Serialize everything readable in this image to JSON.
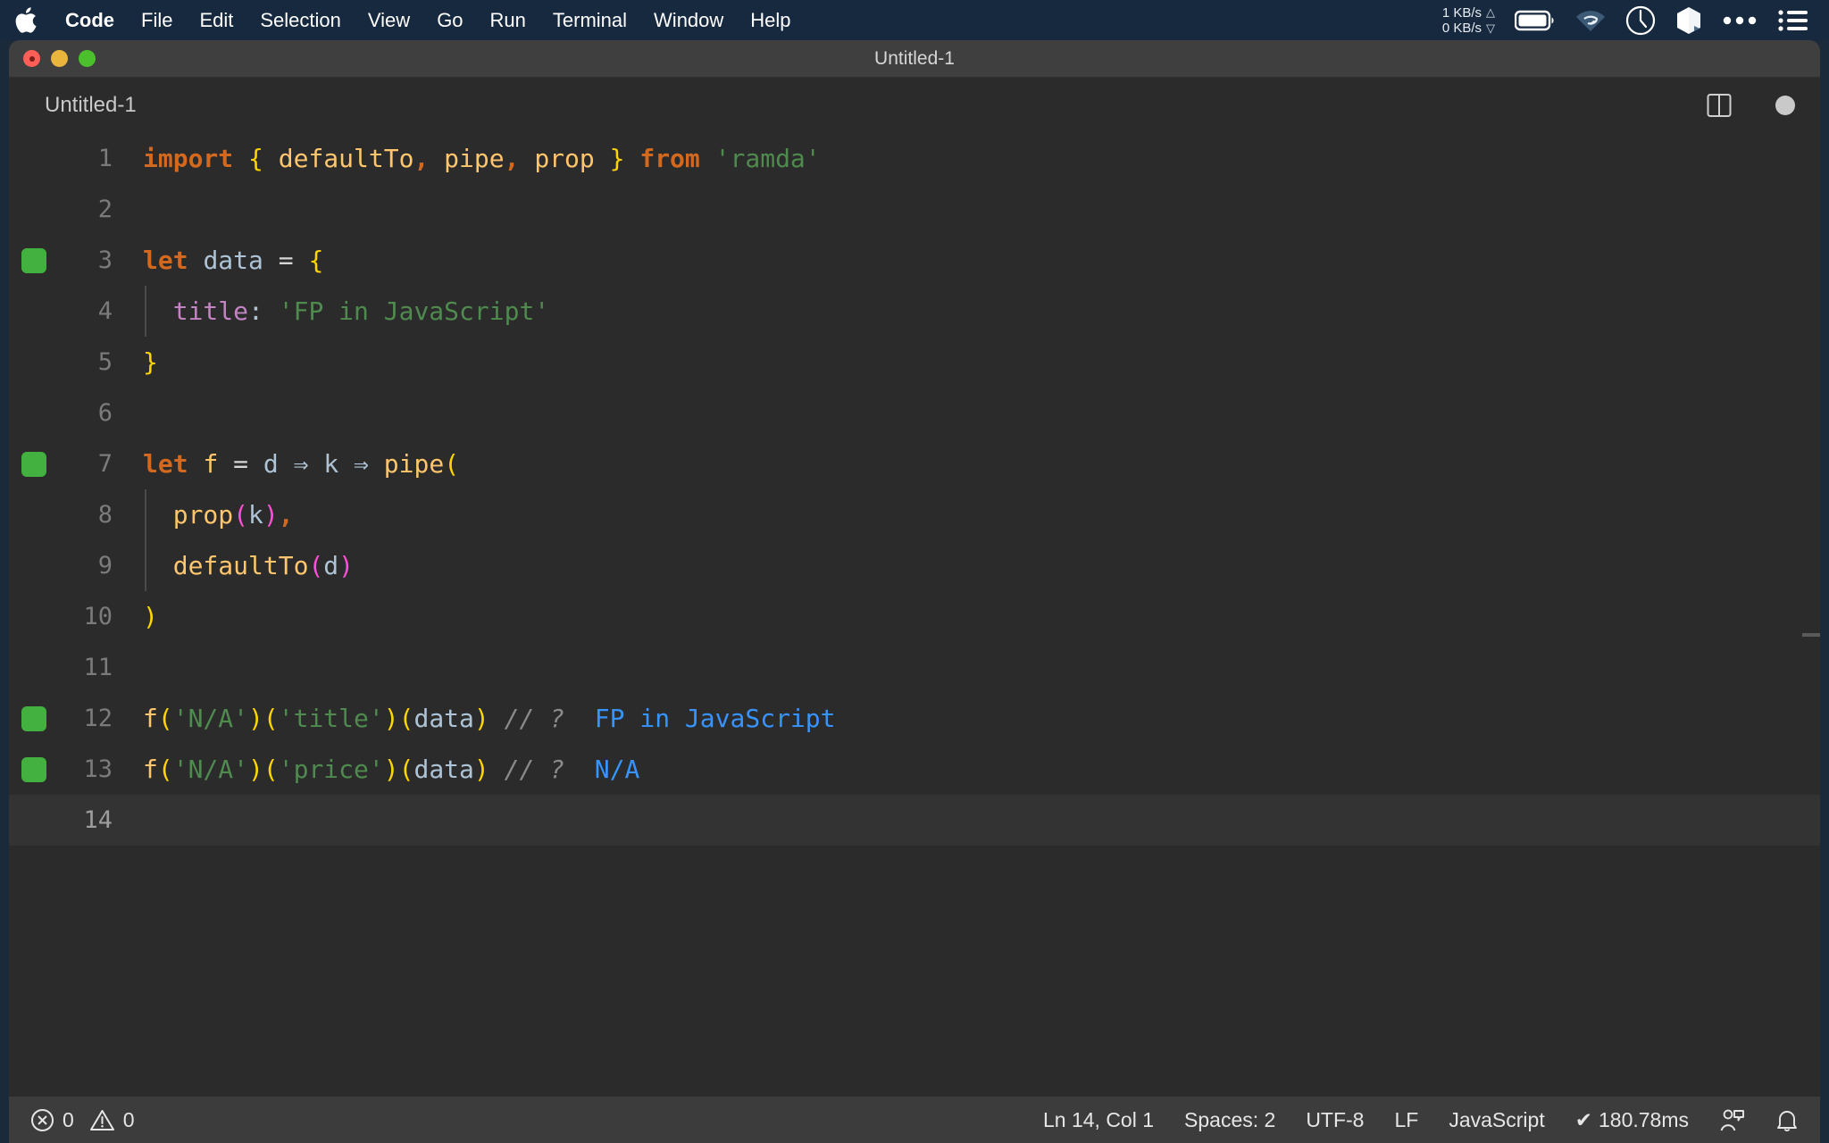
{
  "menubar": {
    "apple_icon": "apple-logo-icon",
    "items": [
      {
        "label": "Code",
        "bold": true
      },
      {
        "label": "File",
        "bold": false
      },
      {
        "label": "Edit",
        "bold": false
      },
      {
        "label": "Selection",
        "bold": false
      },
      {
        "label": "View",
        "bold": false
      },
      {
        "label": "Go",
        "bold": false
      },
      {
        "label": "Run",
        "bold": false
      },
      {
        "label": "Terminal",
        "bold": false
      },
      {
        "label": "Window",
        "bold": false
      },
      {
        "label": "Help",
        "bold": false
      }
    ],
    "network": {
      "upload": "1 KB/s",
      "download": "0 KB/s",
      "up_arrow": "△",
      "down_arrow": "▽"
    },
    "tray": [
      "battery-icon",
      "wifi-icon",
      "clock-icon",
      "dropbox-icon",
      "more-icon",
      "control-center-icon"
    ]
  },
  "window": {
    "title": "Untitled-1",
    "traffic_lights": [
      "close-button",
      "minimize-button",
      "maximize-button"
    ]
  },
  "tabs": {
    "active_label": "Untitled-1",
    "actions": [
      "split-editor-icon",
      "unsaved-dot-icon"
    ]
  },
  "editor": {
    "lines": [
      {
        "num": "1",
        "coverage": false,
        "current": false,
        "indent_guide": false,
        "tokens": [
          {
            "t": "import",
            "c": "kw"
          },
          {
            "t": " ",
            "c": "op"
          },
          {
            "t": "{",
            "c": "brace-y"
          },
          {
            "t": " ",
            "c": "op"
          },
          {
            "t": "defaultTo",
            "c": "fn"
          },
          {
            "t": ",",
            "c": "kw"
          },
          {
            "t": " ",
            "c": "op"
          },
          {
            "t": "pipe",
            "c": "fn"
          },
          {
            "t": ",",
            "c": "kw"
          },
          {
            "t": " ",
            "c": "op"
          },
          {
            "t": "prop",
            "c": "fn"
          },
          {
            "t": " ",
            "c": "op"
          },
          {
            "t": "}",
            "c": "brace-y"
          },
          {
            "t": " ",
            "c": "op"
          },
          {
            "t": "from",
            "c": "kw"
          },
          {
            "t": " ",
            "c": "op"
          },
          {
            "t": "'ramda'",
            "c": "str"
          }
        ]
      },
      {
        "num": "2",
        "coverage": false,
        "current": false,
        "indent_guide": false,
        "tokens": []
      },
      {
        "num": "3",
        "coverage": true,
        "current": false,
        "indent_guide": false,
        "tokens": [
          {
            "t": "let",
            "c": "kw"
          },
          {
            "t": " ",
            "c": "op"
          },
          {
            "t": "data",
            "c": "var"
          },
          {
            "t": " ",
            "c": "op"
          },
          {
            "t": "=",
            "c": "op"
          },
          {
            "t": " ",
            "c": "op"
          },
          {
            "t": "{",
            "c": "brace-y"
          }
        ]
      },
      {
        "num": "4",
        "coverage": false,
        "current": false,
        "indent_guide": true,
        "tokens": [
          {
            "t": "  ",
            "c": "op"
          },
          {
            "t": "title",
            "c": "prop"
          },
          {
            "t": ":",
            "c": "var"
          },
          {
            "t": " ",
            "c": "op"
          },
          {
            "t": "'FP in JavaScript'",
            "c": "str"
          }
        ]
      },
      {
        "num": "5",
        "coverage": false,
        "current": false,
        "indent_guide": false,
        "tokens": [
          {
            "t": "}",
            "c": "brace-y"
          }
        ]
      },
      {
        "num": "6",
        "coverage": false,
        "current": false,
        "indent_guide": false,
        "tokens": []
      },
      {
        "num": "7",
        "coverage": true,
        "current": false,
        "indent_guide": false,
        "tokens": [
          {
            "t": "let",
            "c": "kw"
          },
          {
            "t": " ",
            "c": "op"
          },
          {
            "t": "f",
            "c": "fn"
          },
          {
            "t": " ",
            "c": "op"
          },
          {
            "t": "=",
            "c": "op"
          },
          {
            "t": " ",
            "c": "op"
          },
          {
            "t": "d",
            "c": "var"
          },
          {
            "t": " ",
            "c": "op"
          },
          {
            "t": "⇒",
            "c": "arrow"
          },
          {
            "t": " ",
            "c": "op"
          },
          {
            "t": "k",
            "c": "var"
          },
          {
            "t": " ",
            "c": "op"
          },
          {
            "t": "⇒",
            "c": "arrow"
          },
          {
            "t": " ",
            "c": "op"
          },
          {
            "t": "pipe",
            "c": "fn"
          },
          {
            "t": "(",
            "c": "brace-y"
          }
        ]
      },
      {
        "num": "8",
        "coverage": false,
        "current": false,
        "indent_guide": true,
        "tokens": [
          {
            "t": "  ",
            "c": "op"
          },
          {
            "t": "prop",
            "c": "fn"
          },
          {
            "t": "(",
            "c": "paren-m"
          },
          {
            "t": "k",
            "c": "var"
          },
          {
            "t": ")",
            "c": "paren-m"
          },
          {
            "t": ",",
            "c": "kw"
          }
        ]
      },
      {
        "num": "9",
        "coverage": false,
        "current": false,
        "indent_guide": true,
        "tokens": [
          {
            "t": "  ",
            "c": "op"
          },
          {
            "t": "defaultTo",
            "c": "fn"
          },
          {
            "t": "(",
            "c": "paren-m"
          },
          {
            "t": "d",
            "c": "var"
          },
          {
            "t": ")",
            "c": "paren-m"
          }
        ]
      },
      {
        "num": "10",
        "coverage": false,
        "current": false,
        "indent_guide": false,
        "tokens": [
          {
            "t": ")",
            "c": "brace-y"
          }
        ]
      },
      {
        "num": "11",
        "coverage": false,
        "current": false,
        "indent_guide": false,
        "tokens": []
      },
      {
        "num": "12",
        "coverage": true,
        "current": false,
        "indent_guide": false,
        "tokens": [
          {
            "t": "f",
            "c": "fn"
          },
          {
            "t": "(",
            "c": "brace-y"
          },
          {
            "t": "'N/A'",
            "c": "str"
          },
          {
            "t": ")",
            "c": "brace-y"
          },
          {
            "t": "(",
            "c": "brace-y"
          },
          {
            "t": "'title'",
            "c": "str"
          },
          {
            "t": ")",
            "c": "brace-y"
          },
          {
            "t": "(",
            "c": "brace-y"
          },
          {
            "t": "data",
            "c": "var"
          },
          {
            "t": ")",
            "c": "brace-y"
          },
          {
            "t": " ",
            "c": "op"
          },
          {
            "t": "// ?",
            "c": "comment"
          },
          {
            "t": "  ",
            "c": "op"
          },
          {
            "t": "FP in JavaScript",
            "c": "result"
          }
        ]
      },
      {
        "num": "13",
        "coverage": true,
        "current": false,
        "indent_guide": false,
        "tokens": [
          {
            "t": "f",
            "c": "fn"
          },
          {
            "t": "(",
            "c": "brace-y"
          },
          {
            "t": "'N/A'",
            "c": "str"
          },
          {
            "t": ")",
            "c": "brace-y"
          },
          {
            "t": "(",
            "c": "brace-y"
          },
          {
            "t": "'price'",
            "c": "str"
          },
          {
            "t": ")",
            "c": "brace-y"
          },
          {
            "t": "(",
            "c": "brace-y"
          },
          {
            "t": "data",
            "c": "var"
          },
          {
            "t": ")",
            "c": "brace-y"
          },
          {
            "t": " ",
            "c": "op"
          },
          {
            "t": "// ?",
            "c": "comment"
          },
          {
            "t": "  ",
            "c": "op"
          },
          {
            "t": "N/A",
            "c": "result"
          }
        ]
      },
      {
        "num": "14",
        "coverage": false,
        "current": true,
        "indent_guide": false,
        "tokens": []
      }
    ]
  },
  "statusbar": {
    "errors": "0",
    "warnings": "0",
    "cursor": "Ln 14, Col 1",
    "indent": "Spaces: 2",
    "encoding": "UTF-8",
    "eol": "LF",
    "language": "JavaScript",
    "quokka": "180.78ms",
    "quokka_check": "✔",
    "right_icons": [
      "feedback-icon",
      "bell-icon"
    ]
  },
  "colors": {
    "menubar_bg": "#16293f",
    "editor_bg": "#2b2b2b",
    "titlebar_bg": "#3f3f3f",
    "statusbar_bg": "#3c3c3c",
    "coverage_green": "#42b13f",
    "result_blue": "#3794ff",
    "keyword_orange": "#d2691e",
    "string_green": "#4f8a4f",
    "function_gold": "#ffc66d",
    "brace_yellow": "#ffd500",
    "paren_magenta": "#ff4fd8"
  }
}
